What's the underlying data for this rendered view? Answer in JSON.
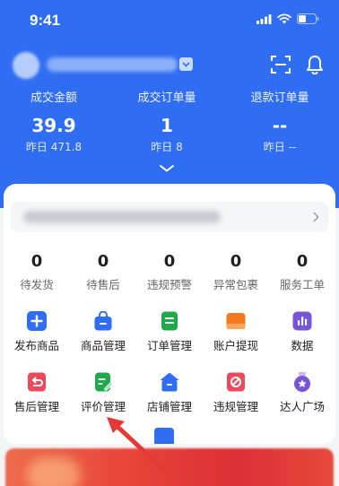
{
  "status_bar": {
    "time": "9:41"
  },
  "header": {
    "shop_name_hidden": true
  },
  "stats": [
    {
      "label": "成交金额",
      "value": "39.9",
      "yesterday": "昨日 471.8"
    },
    {
      "label": "成交订单量",
      "value": "1",
      "yesterday": "昨日 8"
    },
    {
      "label": "退款订单量",
      "value": "--",
      "yesterday": "昨日 --"
    }
  ],
  "order_counts": [
    {
      "value": "0",
      "label": "待发货"
    },
    {
      "value": "0",
      "label": "待售后"
    },
    {
      "value": "0",
      "label": "违规预警"
    },
    {
      "value": "0",
      "label": "异常包裹"
    },
    {
      "value": "0",
      "label": "服务工单"
    }
  ],
  "tools": [
    {
      "label": "发布商品",
      "icon": "plus-icon",
      "color": "#2f6df3"
    },
    {
      "label": "商品管理",
      "icon": "shopping-bag-icon",
      "color": "#2f6df3"
    },
    {
      "label": "订单管理",
      "icon": "order-list-icon",
      "color": "#20a84a"
    },
    {
      "label": "账户提现",
      "icon": "wallet-icon",
      "color": "#f47a1f"
    },
    {
      "label": "数据",
      "icon": "bar-chart-icon",
      "color": "#7656d6"
    },
    {
      "label": "售后管理",
      "icon": "return-icon",
      "color": "#ec4a5b"
    },
    {
      "label": "评价管理",
      "icon": "review-edit-icon",
      "color": "#20a84a"
    },
    {
      "label": "店铺管理",
      "icon": "store-icon",
      "color": "#2f6df3"
    },
    {
      "label": "违规管理",
      "icon": "forbidden-icon",
      "color": "#ec4a5b"
    },
    {
      "label": "达人广场",
      "icon": "star-medal-icon",
      "color": "#7656d6"
    }
  ],
  "colors": {
    "primary": "#2f6df3",
    "annotation_arrow": "#e53935"
  }
}
